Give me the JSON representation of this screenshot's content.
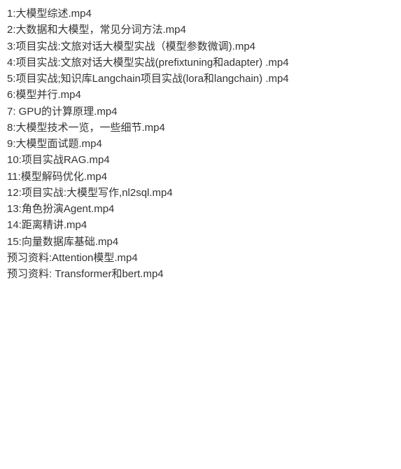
{
  "files": [
    "1:大模型综述.mp4",
    "2:大数据和大模型，常见分词方法.mp4",
    "3:项目实战:文旅对话大模型实战（模型参数微调).mp4",
    "4:项目实战:文旅对话大模型实战(prefixtuning和adapter) .mp4",
    "5:项目实战;知识库Langchain项目实战(lora和langchain) .mp4",
    "6:模型并行.mp4",
    "7: GPU的计算原理.mp4",
    "8:大模型技术一览，一些细节.mp4",
    "9:大模型面试题.mp4",
    "10:项目实战RAG.mp4",
    "11:模型解码优化.mp4",
    "12:项目实战:大模型写作,nl2sql.mp4",
    "13:角色扮演Agent.mp4",
    "14:距离精讲.mp4",
    "15:向量数据库基础.mp4",
    "预习资料:Attention模型.mp4",
    "预习资料: Transformer和bert.mp4"
  ]
}
